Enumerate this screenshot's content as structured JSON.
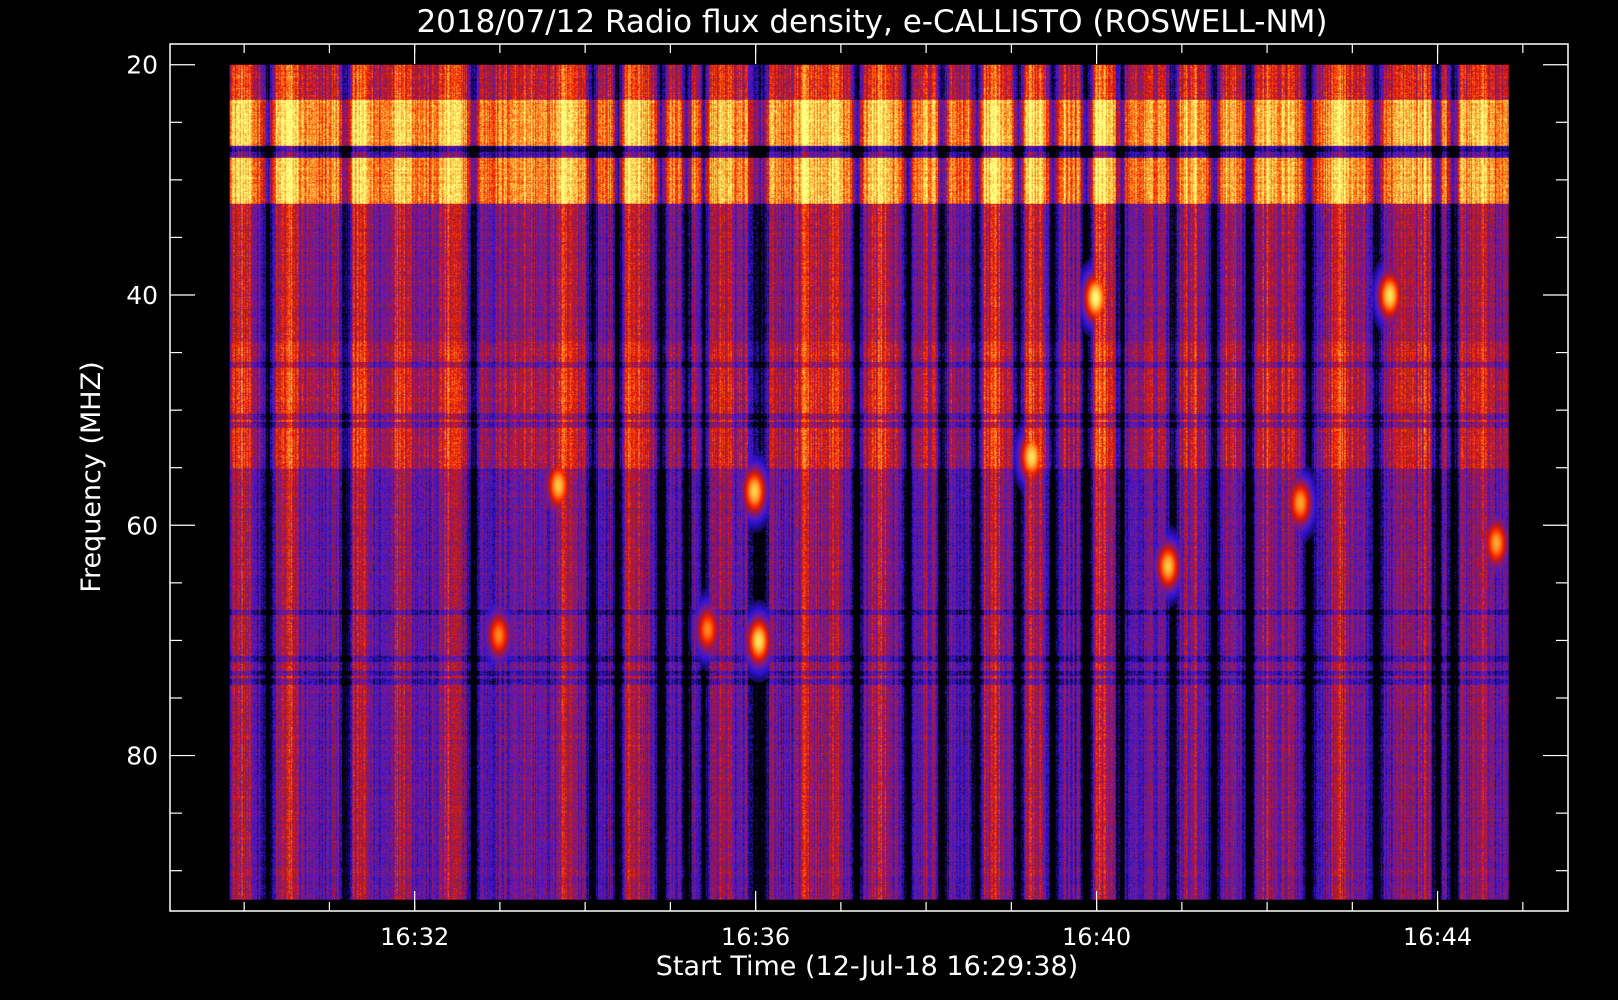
{
  "chart_data": {
    "type": "heatmap",
    "title": "2018/07/12  Radio flux density, e-CALLISTO (ROSWELL-NM)",
    "xlabel": "Start Time (12-Jul-18 16:29:38)",
    "ylabel": "Frequency (MHZ)",
    "x_unit": "minutes after 16:29:38",
    "xlim": [
      -0.5,
      15.9
    ],
    "ylim": [
      18.2,
      93.5
    ],
    "y_inverted": true,
    "data_x_range": [
      0.2,
      15.2
    ],
    "data_y_range": [
      20,
      92.5
    ],
    "x_ticks": [
      {
        "value": 2.37,
        "label": "16:32"
      },
      {
        "value": 6.37,
        "label": "16:36"
      },
      {
        "value": 10.37,
        "label": "16:40"
      },
      {
        "value": 14.37,
        "label": "16:44"
      }
    ],
    "x_minor_step": 1,
    "x_minor_start": 0.37,
    "y_ticks": [
      {
        "value": 20,
        "label": "20"
      },
      {
        "value": 40,
        "label": "40"
      },
      {
        "value": 60,
        "label": "60"
      },
      {
        "value": 80,
        "label": "80"
      }
    ],
    "y_minor_step": 5,
    "grid": false,
    "colormap": [
      "#000000",
      "#1a0a6a",
      "#2c12d8",
      "#5a1ab0",
      "#8a1870",
      "#c01818",
      "#ff2a00",
      "#ff7a1a",
      "#ffc040",
      "#ffff80"
    ],
    "frequency_bands": [
      {
        "from": 20,
        "to": 23,
        "level": 0.55
      },
      {
        "from": 23,
        "to": 27,
        "level": 0.82
      },
      {
        "from": 27,
        "to": 28,
        "level": 0.25
      },
      {
        "from": 28,
        "to": 32,
        "level": 0.8
      },
      {
        "from": 32,
        "to": 44,
        "level": 0.42
      },
      {
        "from": 44,
        "to": 55,
        "level": 0.5
      },
      {
        "from": 55,
        "to": 92.5,
        "level": 0.36
      }
    ],
    "horizontal_lines_mhz": [
      27.3,
      46.0,
      50.5,
      51.2,
      67.5,
      71.5,
      72.8,
      73.5
    ],
    "dark_columns_min": [
      0.65,
      1.55,
      3.05,
      4.45,
      4.75,
      5.25,
      5.55,
      5.75,
      6.35,
      6.45,
      7.55,
      8.15,
      8.55,
      8.95,
      9.45,
      9.85,
      10.25,
      10.65,
      11.25,
      11.75,
      12.15,
      12.85,
      13.65,
      14.35,
      14.55
    ],
    "bright_columns_min": [
      0.35,
      0.9,
      1.75,
      2.2,
      2.75,
      4.1,
      4.9,
      6.0,
      6.95,
      7.3,
      7.85,
      9.15,
      9.6,
      10.4,
      11.5,
      12.35,
      13.2,
      14.25,
      14.9
    ],
    "bursts": [
      {
        "t": 4.05,
        "f": 56.5,
        "intensity": 0.9
      },
      {
        "t": 6.35,
        "f": 57.0,
        "intensity": 0.92
      },
      {
        "t": 6.4,
        "f": 70.0,
        "intensity": 0.95
      },
      {
        "t": 5.8,
        "f": 69.0,
        "intensity": 0.8
      },
      {
        "t": 3.35,
        "f": 69.5,
        "intensity": 0.8
      },
      {
        "t": 11.2,
        "f": 63.5,
        "intensity": 0.9
      },
      {
        "t": 12.75,
        "f": 58.0,
        "intensity": 0.85
      },
      {
        "t": 15.05,
        "f": 61.5,
        "intensity": 0.85
      },
      {
        "t": 9.6,
        "f": 54.0,
        "intensity": 0.95
      },
      {
        "t": 10.35,
        "f": 40.2,
        "intensity": 1.0
      },
      {
        "t": 13.8,
        "f": 40.0,
        "intensity": 0.95
      }
    ]
  }
}
